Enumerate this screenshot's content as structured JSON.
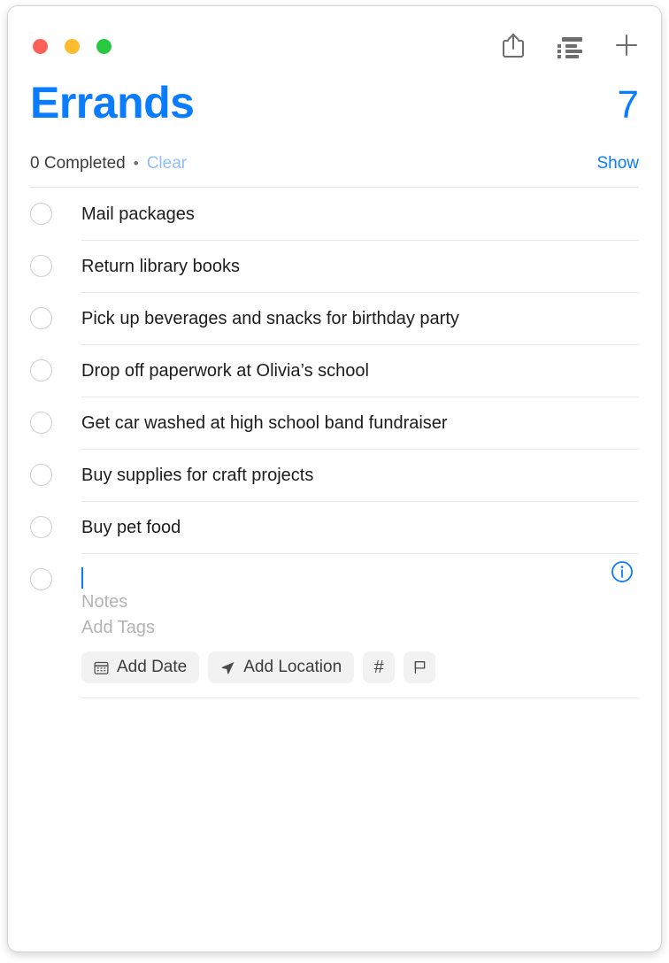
{
  "window": {
    "traffic_lights": [
      {
        "name": "close",
        "color": "#ff6057"
      },
      {
        "name": "minimize",
        "color": "#febc2e"
      },
      {
        "name": "maximize",
        "color": "#28c840"
      }
    ]
  },
  "toolbar": {
    "share_icon": "share-icon",
    "view_options_icon": "list-view-icon",
    "add_icon": "plus-icon"
  },
  "header": {
    "title": "Errands",
    "count": "7",
    "completed_text": "0 Completed",
    "separator_dot": "•",
    "clear_label": "Clear",
    "show_label": "Show"
  },
  "colors": {
    "accent_blue": "#0a7cff",
    "disabled_blue": "#8fbeff",
    "text_primary": "#1c1c1e",
    "placeholder_gray": "#b4b4b4",
    "divider": "#e8e8e8",
    "chip_bg": "#f2f2f3"
  },
  "reminders": [
    {
      "title": "Mail packages",
      "completed": false
    },
    {
      "title": "Return library books",
      "completed": false
    },
    {
      "title": "Pick up beverages and snacks for birthday party",
      "completed": false
    },
    {
      "title": "Drop off paperwork at Olivia’s school",
      "completed": false
    },
    {
      "title": "Get car washed at high school band fundraiser",
      "completed": false
    },
    {
      "title": "Buy supplies for craft projects",
      "completed": false
    },
    {
      "title": "Buy pet food",
      "completed": false
    }
  ],
  "new_reminder": {
    "title_value": "",
    "notes_placeholder": "Notes",
    "tags_placeholder": "Add Tags",
    "info_icon": "info-circle-icon",
    "chips": [
      {
        "label": "Add Date",
        "icon": "calendar-icon"
      },
      {
        "label": "Add Location",
        "icon": "location-arrow-icon"
      },
      {
        "label": "#",
        "icon": "hash-icon"
      },
      {
        "label": "",
        "icon": "flag-icon"
      }
    ]
  }
}
